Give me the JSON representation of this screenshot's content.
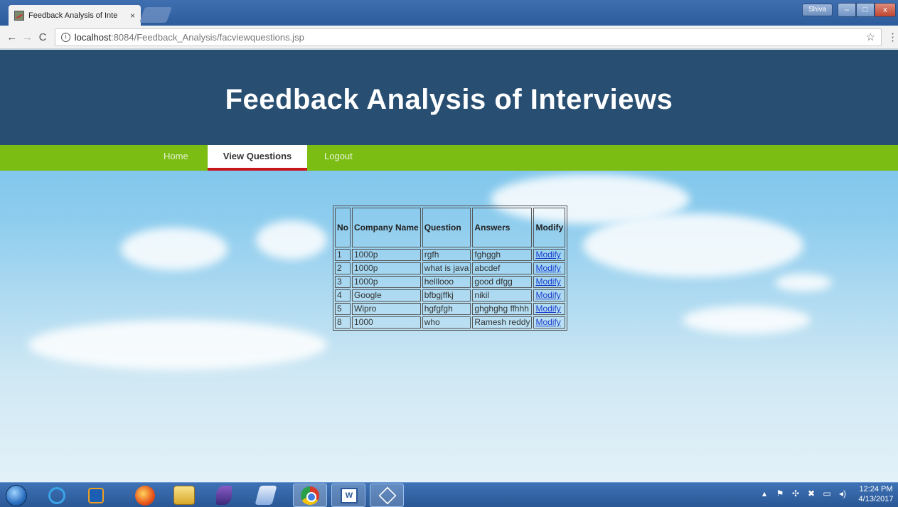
{
  "browser": {
    "tab_title": "Feedback Analysis of Inte",
    "tab_close": "×",
    "window_user": "Shiva",
    "win_min": "–",
    "win_max": "□",
    "win_close": "x",
    "url_host": "localhost",
    "url_path": ":8084/Feedback_Analysis/facviewquestions.jsp",
    "back": "←",
    "forward": "→",
    "reload": "C",
    "info": "i",
    "star": "☆",
    "menu": "⋮"
  },
  "site": {
    "title": "Feedback Analysis of Interviews"
  },
  "nav": {
    "home": "Home",
    "view_questions": "View Questions",
    "logout": "Logout"
  },
  "table": {
    "headers": [
      "No",
      "Company Name",
      "Question",
      "Answers",
      "Modify"
    ],
    "rows": [
      {
        "no": "1",
        "company": "1000p",
        "question": "rgfh",
        "answers": "fghggh",
        "modify": "Modify"
      },
      {
        "no": "2",
        "company": "1000p",
        "question": "what is java",
        "answers": "abcdef",
        "modify": "Modify"
      },
      {
        "no": "3",
        "company": "1000p",
        "question": "helllooo",
        "answers": "good dfgg",
        "modify": "Modify"
      },
      {
        "no": "4",
        "company": "Google",
        "question": "bfbgjffkj",
        "answers": "nikil",
        "modify": "Modify"
      },
      {
        "no": "5",
        "company": "Wipro",
        "question": "hgfgfgh",
        "answers": "ghghghg ffhhh",
        "modify": "Modify"
      },
      {
        "no": "8",
        "company": "1000",
        "question": "who",
        "answers": "Ramesh reddy",
        "modify": "Modify"
      }
    ]
  },
  "taskbar": {
    "clock_time": "12:24 PM",
    "clock_date": "4/13/2017",
    "word_label": "W"
  },
  "colors": {
    "header_bg": "#284f72",
    "navbar_bg": "#7bbd12",
    "active_underline": "#c8161d"
  }
}
